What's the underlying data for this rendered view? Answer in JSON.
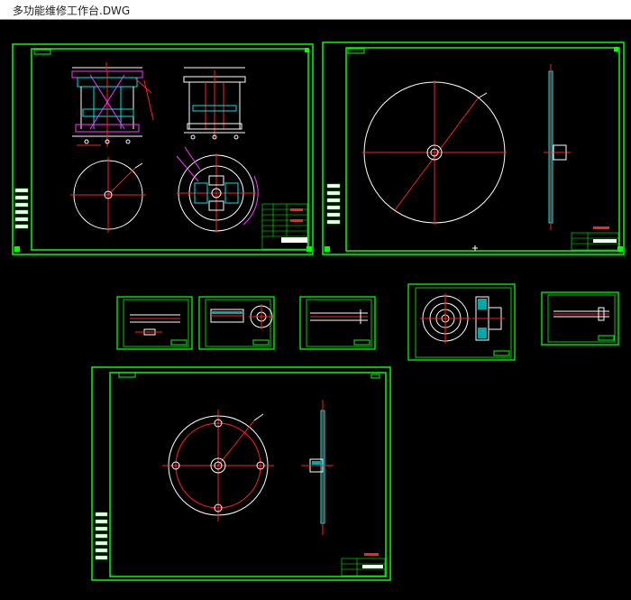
{
  "window": {
    "title": "多功能维修工作台.DWG"
  },
  "colors": {
    "background": "#000000",
    "frame": "#00ff00",
    "title_fill": "#ffffff",
    "line_white": "#ffffff",
    "line_red": "#ff2020",
    "line_cyan": "#00e5e5",
    "line_magenta": "#ff33ff",
    "line_yellow": "#ffff00"
  },
  "icons": {
    "ucs": "ucs-icon"
  }
}
